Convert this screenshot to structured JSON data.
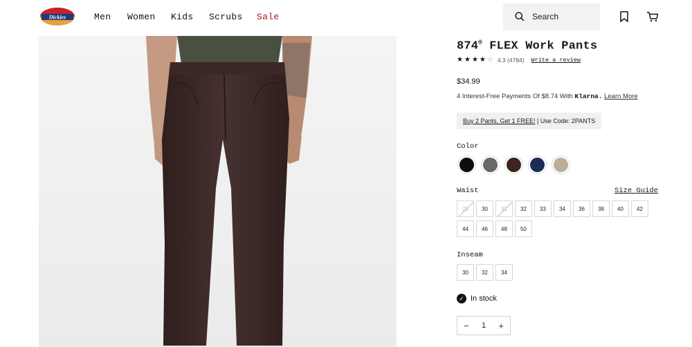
{
  "header": {
    "logo_text": "Dickies",
    "nav": [
      {
        "label": "Men",
        "name": "nav-men"
      },
      {
        "label": "Women",
        "name": "nav-women"
      },
      {
        "label": "Kids",
        "name": "nav-kids"
      },
      {
        "label": "Scrubs",
        "name": "nav-scrubs"
      },
      {
        "label": "Sale",
        "name": "nav-sale"
      }
    ],
    "search_label": "Search",
    "icons": {
      "search": "search-icon",
      "wishlist": "bookmark-icon",
      "cart": "cart-icon"
    }
  },
  "product": {
    "title": "874",
    "title_mark": "®",
    "title_rest": " FLEX Work Pants",
    "rating": 4.3,
    "rating_text": "4.3",
    "review_count": "(4784)",
    "write_review": "Write a review",
    "price": "$34.99",
    "installments_prefix": "4 Interest-Free Payments Of $8.74 With ",
    "installments_brand": "Klarna.",
    "installments_link": "Learn More",
    "promo_link": "Buy 2 Pants, Get 1 FREE!",
    "promo_code": " | Use Code: 2PANTS",
    "color_label": "Color",
    "colors": [
      {
        "name": "black",
        "hex": "#0d0d0d"
      },
      {
        "name": "charcoal",
        "hex": "#686868"
      },
      {
        "name": "dark-brown",
        "hex": "#3a2520"
      },
      {
        "name": "navy",
        "hex": "#1e2b52"
      },
      {
        "name": "khaki",
        "hex": "#bcae98"
      }
    ],
    "waist_label": "Waist",
    "size_guide": "Size Guide",
    "waist_sizes": [
      {
        "label": "28",
        "available": false
      },
      {
        "label": "30",
        "available": true
      },
      {
        "label": "31",
        "available": false
      },
      {
        "label": "32",
        "available": true
      },
      {
        "label": "33",
        "available": true
      },
      {
        "label": "34",
        "available": true
      },
      {
        "label": "36",
        "available": true
      },
      {
        "label": "38",
        "available": true
      },
      {
        "label": "40",
        "available": true
      },
      {
        "label": "42",
        "available": true
      },
      {
        "label": "44",
        "available": true
      },
      {
        "label": "46",
        "available": true
      },
      {
        "label": "48",
        "available": true
      },
      {
        "label": "50",
        "available": true
      }
    ],
    "inseam_label": "Inseam",
    "inseam_sizes": [
      {
        "label": "30",
        "available": true
      },
      {
        "label": "32",
        "available": true
      },
      {
        "label": "34",
        "available": true
      }
    ],
    "stock_text": "In stock",
    "quantity": "1",
    "qty_minus": "−",
    "qty_plus": "+"
  }
}
